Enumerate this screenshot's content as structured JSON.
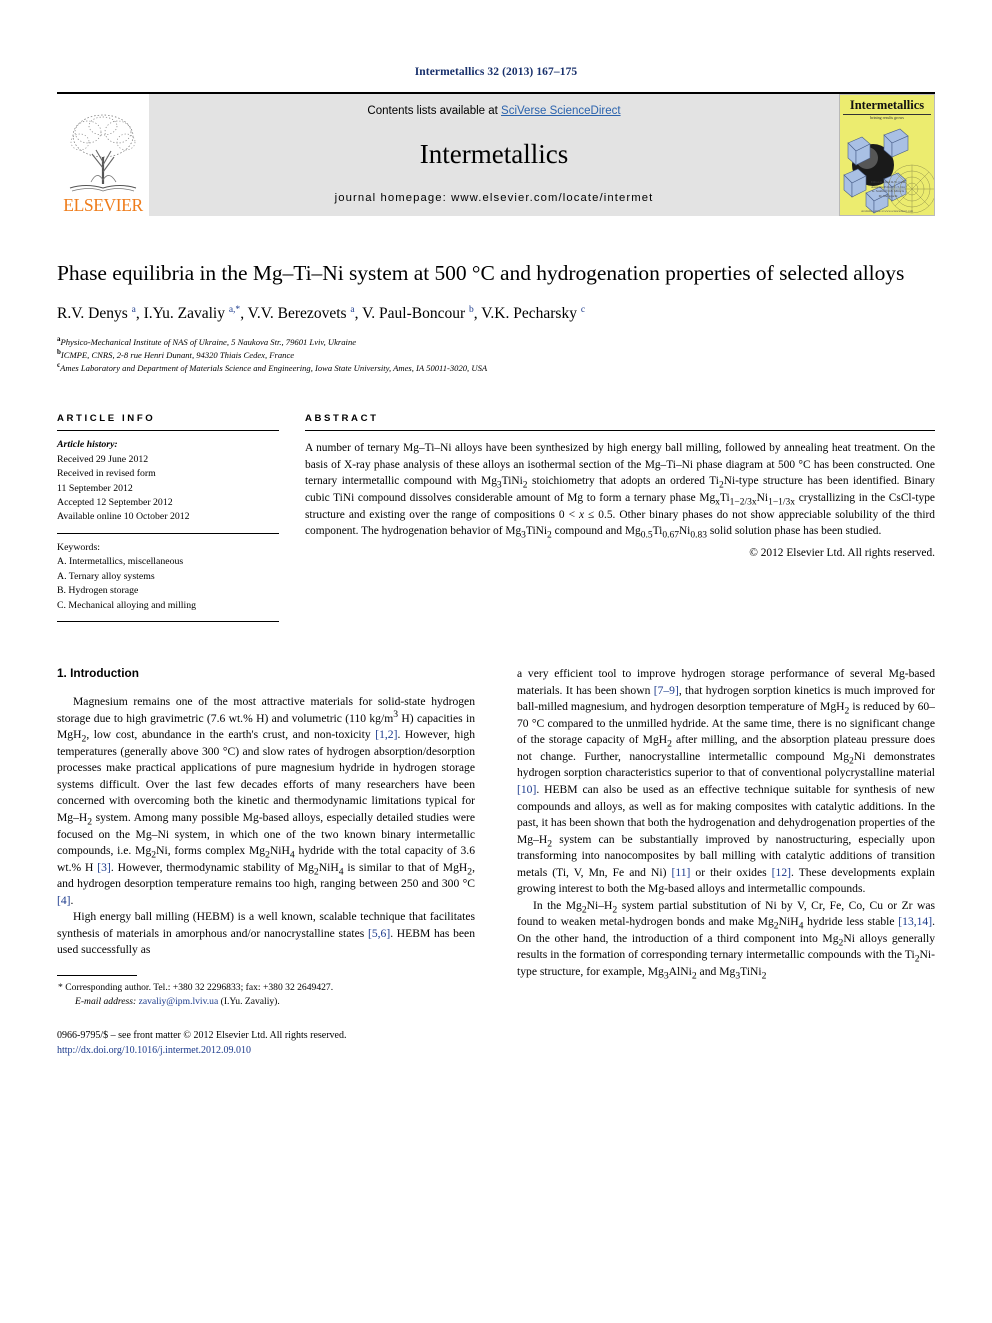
{
  "running_head": "Intermetallics 32 (2013) 167–175",
  "masthead": {
    "publisher_logo_label": "ELSEVIER",
    "contents_prefix": "Contents lists available at ",
    "contents_link": "SciVerse ScienceDirect",
    "journal_name": "Intermetallics",
    "homepage_label": "journal homepage: www.elsevier.com/locate/intermet",
    "cover": {
      "title": "Intermetallics",
      "subtitle": "brining results grows",
      "side_lines": "Editor-in-Chief\nR.W. Cahn\nAssociate Editors\nC.T. Liu\nG. Sauthoff\nD.B. Miracle\nM. Yamaguchi",
      "footer": "Available online at www.sciencedirect.com"
    }
  },
  "article": {
    "title": "Phase equilibria in the Mg–Ti–Ni system at 500 °C and hydrogenation properties of selected alloys",
    "authors_html": "R.V. Denys <sup class=\"af\">a</sup>, I.Yu. Zavaliy <sup class=\"af\">a,*</sup>, V.V. Berezovets <sup class=\"af\">a</sup>, V. Paul-Boncour <sup class=\"af\">b</sup>, V.K. Pecharsky <sup class=\"af\">c</sup>",
    "affiliations": [
      {
        "marker": "a",
        "text": "Physico-Mechanical Institute of NAS of Ukraine, 5 Naukova Str., 79601 Lviv, Ukraine"
      },
      {
        "marker": "b",
        "text": "ICMPE, CNRS, 2-8 rue Henri Dunant, 94320 Thiais Cedex, France"
      },
      {
        "marker": "c",
        "text": "Ames Laboratory and Department of Materials Science and Engineering, Iowa State University, Ames, IA 50011-3020, USA"
      }
    ]
  },
  "article_info": {
    "heading": "ARTICLE INFO",
    "history_label": "Article history:",
    "history": [
      "Received 29 June 2012",
      "Received in revised form",
      "11 September 2012",
      "Accepted 12 September 2012",
      "Available online 10 October 2012"
    ],
    "keywords_label": "Keywords:",
    "keywords": [
      "A. Intermetallics, miscellaneous",
      "A. Ternary alloy systems",
      "B. Hydrogen storage",
      "C. Mechanical alloying and milling"
    ]
  },
  "abstract": {
    "heading": "ABSTRACT",
    "body_html": "A number of ternary Mg–Ti–Ni alloys have been synthesized by high energy ball milling, followed by annealing heat treatment. On the basis of X-ray phase analysis of these alloys an isothermal section of the Mg–Ti–Ni phase diagram at 500 °C has been constructed. One ternary intermetallic compound with Mg<sub>3</sub>TiNi<sub>2</sub> stoichiometry that adopts an ordered Ti<sub>2</sub>Ni-type structure has been identified. Binary cubic TiNi compound dissolves considerable amount of Mg to form a ternary phase Mg<sub>x</sub>Ti<sub>1−2/3x</sub>Ni<sub>1−1/3x</sub> crystallizing in the CsCl-type structure and existing over the range of compositions 0 &lt; <i>x</i> ≤ 0.5. Other binary phases do not show appreciable solubility of the third component. The hydrogenation behavior of Mg<sub>3</sub>TiNi<sub>2</sub> compound and Mg<sub>0.5</sub>Ti<sub>0.67</sub>Ni<sub>0.83</sub> solid solution phase has been studied.",
    "copyright": "© 2012 Elsevier Ltd. All rights reserved."
  },
  "body": {
    "section_number_title": "1. Introduction",
    "left_paragraphs_html": [
      "Magnesium remains one of the most attractive materials for solid-state hydrogen storage due to high gravimetric (7.6 wt.% H) and volumetric (110 kg/m<sup>3</sup> H) capacities in MgH<sub>2</sub>, low cost, abundance in the earth's crust, and non-toxicity <span class=\"ref\">[1,2]</span>. However, high temperatures (generally above 300 °C) and slow rates of hydrogen absorption/desorption processes make practical applications of pure magnesium hydride in hydrogen storage systems difficult. Over the last few decades efforts of many researchers have been concerned with overcoming both the kinetic and thermodynamic limitations typical for Mg–H<sub>2</sub> system. Among many possible Mg-based alloys, especially detailed studies were focused on the Mg–Ni system, in which one of the two known binary intermetallic compounds, i.e. Mg<sub>2</sub>Ni, forms complex Mg<sub>2</sub>NiH<sub>4</sub> hydride with the total capacity of 3.6 wt.% H <span class=\"ref\">[3]</span>. However, thermodynamic stability of Mg<sub>2</sub>NiH<sub>4</sub> is similar to that of MgH<sub>2</sub>, and hydrogen desorption temperature remains too high, ranging between 250 and 300 °C <span class=\"ref\">[4]</span>.",
      "High energy ball milling (HEBM) is a well known, scalable technique that facilitates synthesis of materials in amorphous and/or nanocrystalline states <span class=\"ref\">[5,6]</span>. HEBM has been used successfully as"
    ],
    "right_paragraphs_html": [
      "a very efficient tool to improve hydrogen storage performance of several Mg-based materials. It has been shown <span class=\"ref\">[7–9]</span>, that hydrogen sorption kinetics is much improved for ball-milled magnesium, and hydrogen desorption temperature of MgH<sub>2</sub> is reduced by 60–70 °C compared to the unmilled hydride. At the same time, there is no significant change of the storage capacity of MgH<sub>2</sub> after milling, and the absorption plateau pressure does not change. Further, nanocrystalline intermetallic compound Mg<sub>2</sub>Ni demonstrates hydrogen sorption characteristics superior to that of conventional polycrystalline material <span class=\"ref\">[10]</span>. HEBM can also be used as an effective technique suitable for synthesis of new compounds and alloys, as well as for making composites with catalytic additions. In the past, it has been shown that both the hydrogenation and dehydrogenation properties of the Mg–H<sub>2</sub> system can be substantially improved by nanostructuring, especially upon transforming into nanocomposites by ball milling with catalytic additions of transition metals (Ti, V, Mn, Fe and Ni) <span class=\"ref\">[11]</span> or their oxides <span class=\"ref\">[12]</span>. These developments explain growing interest to both the Mg-based alloys and intermetallic compounds.",
      "In the Mg<sub>2</sub>Ni–H<sub>2</sub> system partial substitution of Ni by V, Cr, Fe, Co, Cu or Zr was found to weaken metal-hydrogen bonds and make Mg<sub>2</sub>NiH<sub>4</sub> hydride less stable <span class=\"ref\">[13,14]</span>. On the other hand, the introduction of a third component into Mg<sub>2</sub>Ni alloys generally results in the formation of corresponding ternary intermetallic compounds with the Ti<sub>2</sub>Ni-type structure, for example, Mg<sub>3</sub>AlNi<sub>2</sub> and Mg<sub>3</sub>TiNi<sub>2</sub>"
    ]
  },
  "footnotes": {
    "corresponding_html": "* Corresponding author. Tel.: +380 32 2296833; fax: +380 32 2649427.",
    "email_html": "<span class=\"em\">E-mail address:</span> <span class=\"mail\">zavaliy@ipm.lviv.ua</span> (I.Yu. Zavaliy)."
  },
  "footer": {
    "issn_line": "0966-9795/$ – see front matter © 2012 Elsevier Ltd. All rights reserved.",
    "doi_line": "http://dx.doi.org/10.1016/j.intermet.2012.09.010"
  },
  "colors": {
    "link_blue": "#2b63ad",
    "ref_blue": "#1b3a8c",
    "elsevier_orange": "#ef7c1a",
    "band_gray": "#e3e3e3",
    "cover_yellow": "#ecec6f"
  }
}
